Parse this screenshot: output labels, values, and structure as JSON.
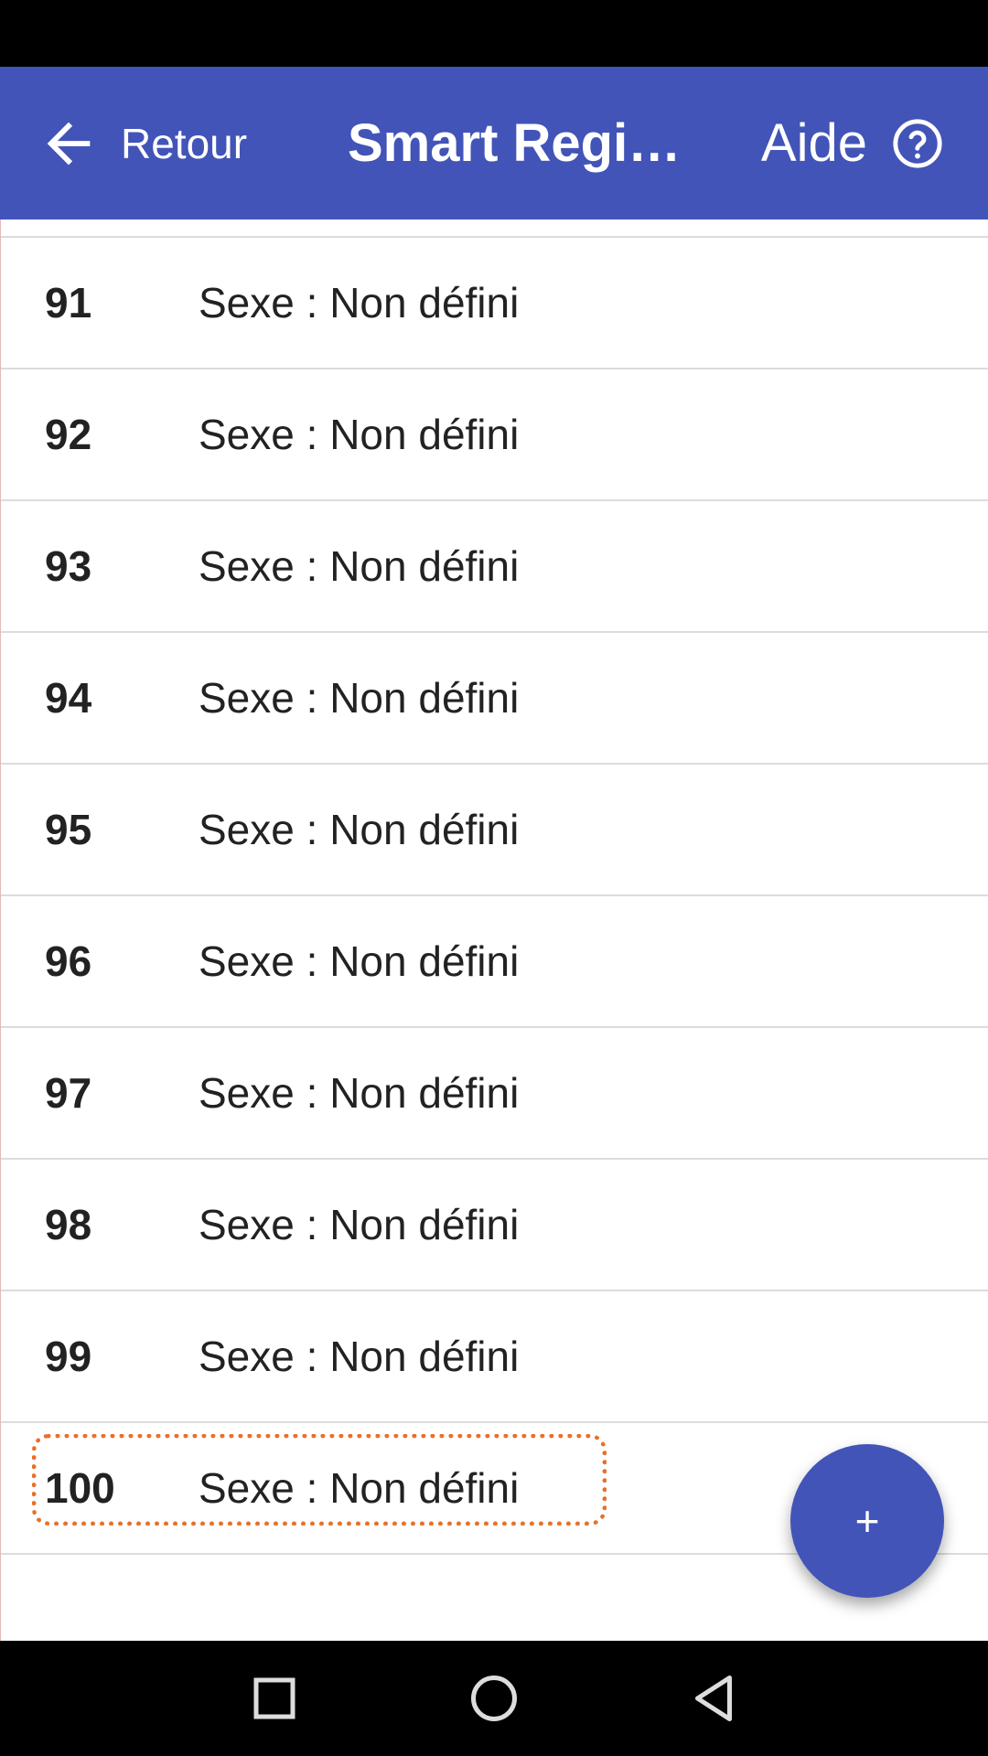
{
  "header": {
    "back_label": "Retour",
    "title": "Smart Regi…",
    "help_label": "Aide"
  },
  "list": {
    "items": [
      {
        "number": "91",
        "label": "Sexe : Non défini"
      },
      {
        "number": "92",
        "label": "Sexe : Non défini"
      },
      {
        "number": "93",
        "label": "Sexe : Non défini"
      },
      {
        "number": "94",
        "label": "Sexe : Non défini"
      },
      {
        "number": "95",
        "label": "Sexe : Non défini"
      },
      {
        "number": "96",
        "label": "Sexe : Non défini"
      },
      {
        "number": "97",
        "label": "Sexe : Non défini"
      },
      {
        "number": "98",
        "label": "Sexe : Non défini"
      },
      {
        "number": "99",
        "label": "Sexe : Non défini"
      },
      {
        "number": "100",
        "label": "Sexe : Non défini"
      }
    ]
  },
  "fab": {
    "label": "+"
  },
  "colors": {
    "primary": "#4254b8",
    "focus": "#e8702a"
  },
  "icons": {
    "back": "arrow-left-icon",
    "help": "help-circle-icon",
    "recents": "square-icon",
    "home": "circle-icon",
    "back_nav": "triangle-back-icon"
  }
}
